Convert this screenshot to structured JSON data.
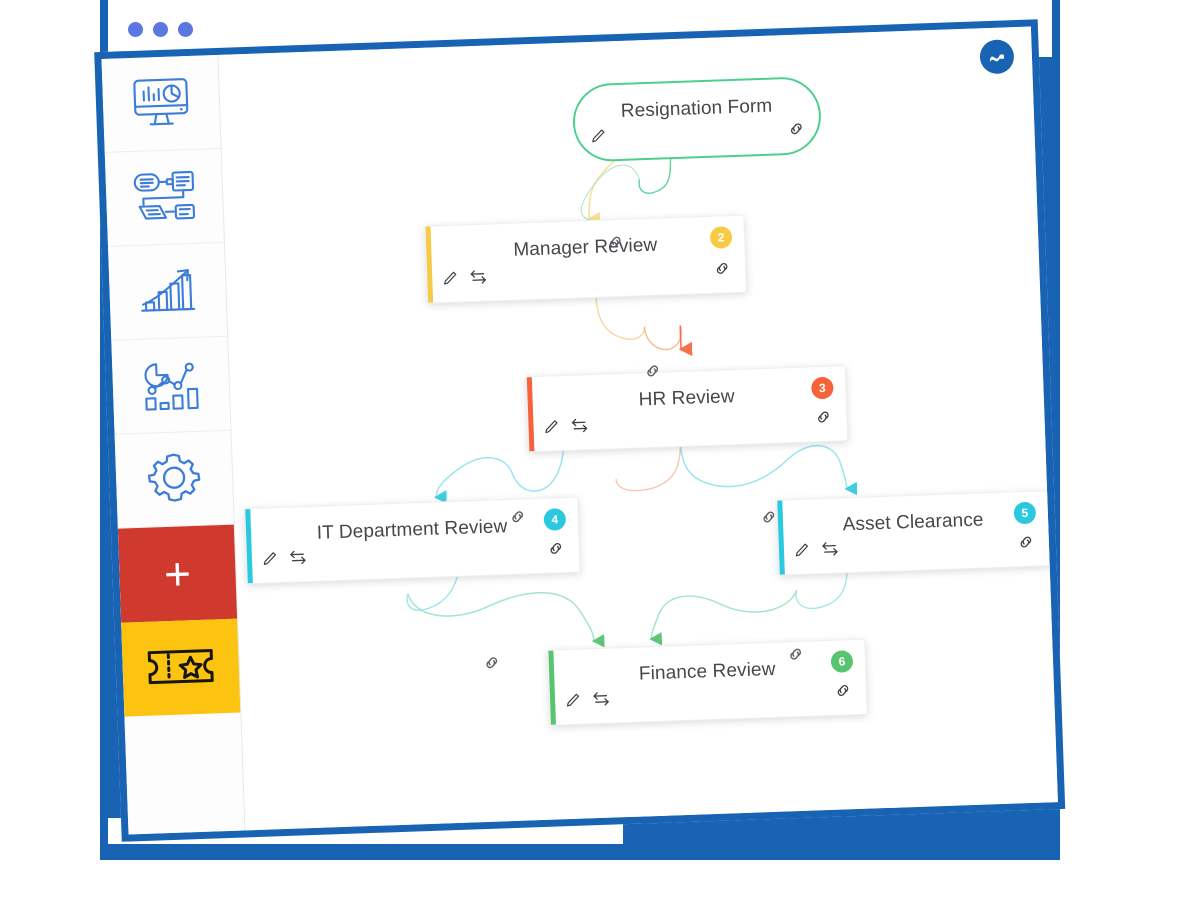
{
  "window": {
    "title_dots": [
      "dot-1",
      "dot-2",
      "dot-3"
    ],
    "frame_color": "#1963b4",
    "dot_color": "#5a78e0"
  },
  "brand": {
    "name": "brand-logo",
    "glyph": "〜",
    "color": "#1963b4"
  },
  "sidebar": {
    "items": [
      {
        "name": "dashboard",
        "icon": "monitor-analytics-icon",
        "color": "#3b7dd8"
      },
      {
        "name": "workflow",
        "icon": "workflow-diagram-icon",
        "color": "#3b7dd8"
      },
      {
        "name": "reports",
        "icon": "growth-bar-chart-icon",
        "color": "#3b7dd8"
      },
      {
        "name": "analytics",
        "icon": "mixed-chart-icon",
        "color": "#3b7dd8"
      },
      {
        "name": "settings",
        "icon": "gear-icon",
        "color": "#3b7dd8"
      },
      {
        "name": "add-new",
        "icon": "plus-icon",
        "color": "#d0392e",
        "label": "+"
      },
      {
        "name": "tickets",
        "icon": "ticket-star-icon",
        "color": "#fcc310"
      }
    ]
  },
  "flow": {
    "nodes": [
      {
        "id": "resignation-form",
        "title": "Resignation Form",
        "shape": "pill",
        "accent": "#4ccf8e",
        "badge": null,
        "icons": [
          "pencil-icon",
          "link-icon"
        ]
      },
      {
        "id": "manager-review",
        "title": "Manager Review",
        "shape": "card",
        "accent": "#f7ca45",
        "badge": "2",
        "badge_color": "#f7ca45",
        "icons": [
          "pencil-icon",
          "swap-arrows-icon",
          "link-icon"
        ]
      },
      {
        "id": "hr-review",
        "title": "HR Review",
        "shape": "card",
        "accent": "#f8623a",
        "badge": "3",
        "badge_color": "#f8623a",
        "icons": [
          "pencil-icon",
          "swap-arrows-icon",
          "link-icon"
        ]
      },
      {
        "id": "it-department-review",
        "title": "IT Department Review",
        "shape": "card",
        "accent": "#2ac9e0",
        "badge": "4",
        "badge_color": "#2ac9e0",
        "icons": [
          "pencil-icon",
          "swap-arrows-icon",
          "link-icon"
        ]
      },
      {
        "id": "asset-clearance",
        "title": "Asset Clearance",
        "shape": "card",
        "accent": "#2ac9e0",
        "badge": "5",
        "badge_color": "#2ac9e0",
        "icons": [
          "pencil-icon",
          "swap-arrows-icon",
          "link-icon"
        ]
      },
      {
        "id": "finance-review",
        "title": "Finance Review",
        "shape": "card",
        "accent": "#58c470",
        "badge": "6",
        "badge_color": "#58c470",
        "icons": [
          "pencil-icon",
          "swap-arrows-icon",
          "link-icon"
        ]
      }
    ],
    "connectors": [
      {
        "from": "resignation-form",
        "to": "manager-review",
        "color": "#f7ca45",
        "link_icon": "link-icon"
      },
      {
        "from": "resignation-form",
        "to": "hr-review",
        "color": "#4ccf8e",
        "link_icon": "link-icon"
      },
      {
        "from": "manager-review",
        "to": "hr-review",
        "color": "#f8623a",
        "link_icon": "link-icon"
      },
      {
        "from": "hr-review",
        "to": "it-department-review",
        "color": "#2ac9e0",
        "link_icon": "link-icon"
      },
      {
        "from": "hr-review",
        "to": "asset-clearance",
        "color": "#2ac9e0",
        "link_icon": "link-icon"
      },
      {
        "from": "it-department-review",
        "to": "finance-review",
        "color": "#58c470",
        "link_icon": "link-icon"
      },
      {
        "from": "asset-clearance",
        "to": "finance-review",
        "color": "#58c470",
        "link_icon": "link-icon"
      }
    ]
  }
}
